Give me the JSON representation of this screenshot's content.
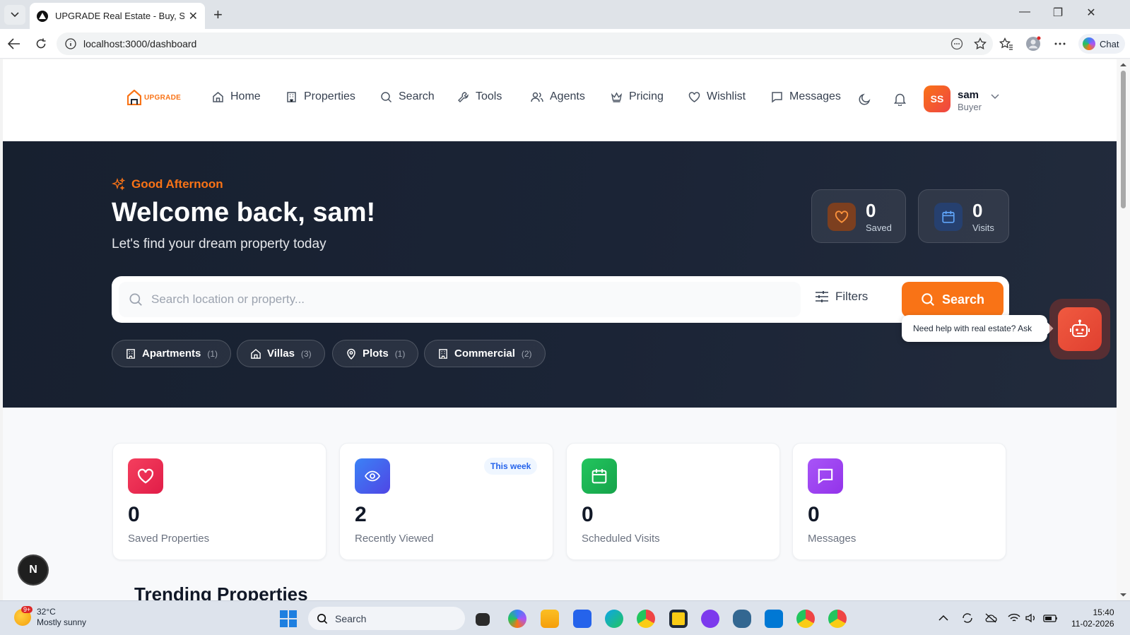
{
  "browser": {
    "tab_title": "UPGRADE Real Estate - Buy, Sell &",
    "url": "localhost:3000/dashboard",
    "chat_label": "Chat"
  },
  "header": {
    "logo_text": "UPGRADE",
    "nav": [
      "Home",
      "Properties",
      "Search",
      "Tools",
      "Agents",
      "Pricing",
      "Wishlist",
      "Messages"
    ],
    "user": {
      "initials": "SS",
      "name": "sam",
      "role": "Buyer"
    }
  },
  "hero": {
    "greeting": "Good Afternoon",
    "welcome": "Welcome back, sam!",
    "tagline": "Let's find your dream property today",
    "stats": [
      {
        "value": "0",
        "label": "Saved"
      },
      {
        "value": "0",
        "label": "Visits"
      }
    ],
    "search": {
      "placeholder": "Search location or property...",
      "filters_label": "Filters",
      "button_label": "Search"
    },
    "categories": [
      {
        "label": "Apartments",
        "count": "(1)"
      },
      {
        "label": "Villas",
        "count": "(3)"
      },
      {
        "label": "Plots",
        "count": "(1)"
      },
      {
        "label": "Commercial",
        "count": "(2)"
      }
    ]
  },
  "assistant": {
    "tooltip": "Need help with real estate? Ask"
  },
  "stat_cards": [
    {
      "value": "0",
      "label": "Saved Properties",
      "color": "#f43f5e"
    },
    {
      "value": "2",
      "label": "Recently Viewed",
      "badge": "This week",
      "color": "#3b82f6"
    },
    {
      "value": "0",
      "label": "Scheduled Visits",
      "color": "#22c55e"
    },
    {
      "value": "0",
      "label": "Messages",
      "color": "#a855f7"
    }
  ],
  "section_title": "Trending Properties",
  "dev_badge": "N",
  "taskbar": {
    "weather_temp": "32°C",
    "weather_desc": "Mostly sunny",
    "weather_badge": "9+",
    "search_label": "Search",
    "time": "15:40",
    "date": "11-02-2026"
  },
  "colors": {
    "accent": "#f97316",
    "hero_bg": "#1b2436"
  }
}
